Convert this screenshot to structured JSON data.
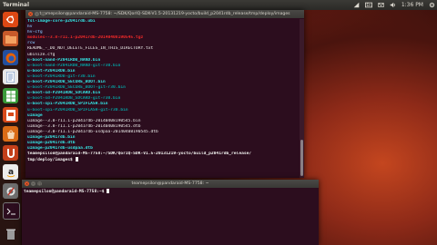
{
  "panel": {
    "title": "Terminal",
    "tray": {
      "time": "1:36 PM",
      "icons": [
        "network-icon",
        "keyboard-icon",
        "mail-icon",
        "volume-icon",
        "settings-gear-icon"
      ]
    }
  },
  "launcher": {
    "items": [
      {
        "name": "ubuntu-logo-icon",
        "color": "#dd4814"
      },
      {
        "name": "folder-icon",
        "color": "#c85a2a"
      },
      {
        "name": "firefox-icon",
        "color": "#e66000"
      },
      {
        "name": "document-icon",
        "color": "#f0f0f0"
      },
      {
        "name": "spreadsheet-icon",
        "color": "#3a9a3a"
      },
      {
        "name": "presentation-icon",
        "color": "#d84a1b"
      },
      {
        "name": "software-center-icon",
        "color": "#d96b17"
      },
      {
        "name": "ubuntu-one-icon",
        "color": "#c33f1a"
      },
      {
        "name": "amazon-icon",
        "color": "#ececec"
      },
      {
        "name": "system-settings-icon",
        "color": "#7a7a7a"
      },
      {
        "name": "terminal-icon",
        "color": "#2c0d1e"
      },
      {
        "name": "trash-icon",
        "color": "#8f8f8f"
      }
    ]
  },
  "terminal_main": {
    "title": "teamepsilon@pandaraid-MS-7758: ~/SDK/QorIQ-SDK-V1.5-20131219-yocto/build_p2041rdb_release/tmp/deploy/images",
    "lines": [
      {
        "text": "fsl-image-core-p2041rdb.ubi",
        "cls": "c-cyan"
      },
      {
        "text": "hv",
        "cls": "c-blue"
      },
      {
        "text": "hv-cfg",
        "cls": "c-blue"
      },
      {
        "text": "modules--3.8-r11.1-p2041rdb-20140408190545.tgz",
        "cls": "c-red"
      },
      {
        "text": "rcw",
        "cls": "c-blue"
      },
      {
        "text": "README_-_DO_NOT_DELETE_FILES_IN_THIS_DIRECTORY.txt",
        "cls": "c-white"
      },
      {
        "text": "ubinize.cfg",
        "cls": "c-white"
      },
      {
        "text": "u-boot-nand-P2041RDB_NAND.bin",
        "cls": "c-cyan"
      },
      {
        "text": "u-boot-nand-P2041RDB_NAND-git-r30.bin",
        "cls": "c-teal"
      },
      {
        "text": "u-boot-P2041RDB.bin",
        "cls": "c-cyan"
      },
      {
        "text": "u-boot-P2041RDB-git-r30.bin",
        "cls": "c-teal"
      },
      {
        "text": "u-boot-P2041RDB_SECURE_BOOT.bin",
        "cls": "c-cyan"
      },
      {
        "text": "u-boot-P2041RDB_SECURE_BOOT-git-r30.bin",
        "cls": "c-teal"
      },
      {
        "text": "u-boot-sd-P2041RDB_SDCARD.bin",
        "cls": "c-cyan"
      },
      {
        "text": "u-boot-sd-P2041RDB_SDCARD-git-r30.bin",
        "cls": "c-teal"
      },
      {
        "text": "u-boot-spi-P2041RDB_SPIFLASH.bin",
        "cls": "c-cyan"
      },
      {
        "text": "u-boot-spi-P2041RDB_SPIFLASH-git-r30.bin",
        "cls": "c-teal"
      },
      {
        "text": "uImage",
        "cls": "c-cyan"
      },
      {
        "text": "uImage--3.8-r11.1-p2041rdb-20140408190545.bin",
        "cls": "c-white"
      },
      {
        "text": "uImage--3.8-r11.1-p2041rdb-20140408190545.dtb",
        "cls": "c-white"
      },
      {
        "text": "uImage--3.8-r11.1-p2041rdb-usdpaa-20140408190545.dtb",
        "cls": "c-white"
      },
      {
        "text": "uImage-p2041rdb.bin",
        "cls": "c-cyan"
      },
      {
        "text": "uImage-p2041rdb.dtb",
        "cls": "c-cyan"
      },
      {
        "text": "uImage-p2041rdb-usdpaa.dtb",
        "cls": "c-cyan"
      },
      {
        "text": "teamepsilon@pandaraid-MS-7758:~/SDK/QorIQ-SDK-V1.5-20131219-yocto/build_p2041rdb_release/",
        "cls": "c-prompt"
      },
      {
        "text": "tmp/deploy/images$ ",
        "cls": "c-prompt",
        "cursor": true
      }
    ]
  },
  "terminal_second": {
    "title": "teamepsilon@pandaraid-MS-7758: ~",
    "lines": [
      {
        "text": "teamepsilon@pandaraid-MS-7758:~$ ",
        "cls": "c-prompt",
        "cursor": true
      }
    ]
  }
}
